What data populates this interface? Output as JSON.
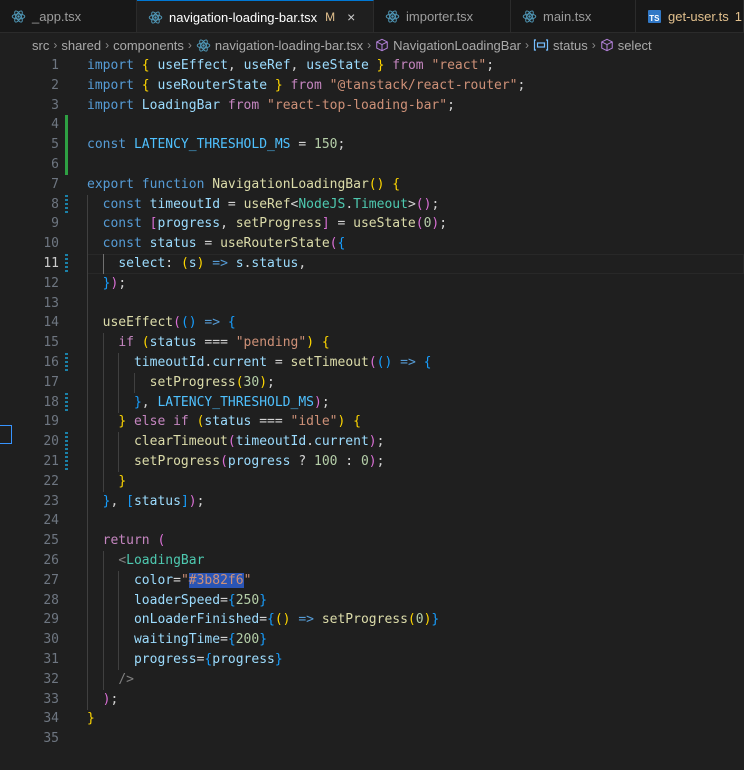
{
  "tabs": [
    {
      "label": "_app.tsx",
      "icon": "react-icon",
      "width": 137,
      "active": false
    },
    {
      "label": "navigation-loading-bar.tsx",
      "icon": "react-icon",
      "width": 237,
      "active": true,
      "modified": "M",
      "close": "×"
    },
    {
      "label": "importer.tsx",
      "icon": "react-icon",
      "width": 137,
      "active": false
    },
    {
      "label": "main.tsx",
      "icon": "react-icon",
      "width": 125,
      "active": false
    },
    {
      "label": "get-user.ts",
      "icon": "ts-icon",
      "width": 108,
      "active": false,
      "extra": "1"
    }
  ],
  "breadcrumb": {
    "parts": [
      "src",
      "shared",
      "components",
      "navigation-loading-bar.tsx",
      "NavigationLoadingBar",
      "status",
      "select"
    ]
  },
  "editor": {
    "current_line": 11,
    "lines": [
      {
        "n": "1",
        "t": [
          [
            "kw",
            "import"
          ],
          [
            "punc",
            " "
          ],
          [
            "b1",
            "{"
          ],
          [
            "punc",
            " "
          ],
          [
            "var",
            "useEffect"
          ],
          [
            "punc",
            ", "
          ],
          [
            "var",
            "useRef"
          ],
          [
            "punc",
            ", "
          ],
          [
            "var",
            "useState"
          ],
          [
            "punc",
            " "
          ],
          [
            "b1",
            "}"
          ],
          [
            "punc",
            " "
          ],
          [
            "ctl",
            "from"
          ],
          [
            "punc",
            " "
          ],
          [
            "str",
            "\"react\""
          ],
          [
            "punc",
            ";"
          ]
        ]
      },
      {
        "n": "2",
        "t": [
          [
            "kw",
            "import"
          ],
          [
            "punc",
            " "
          ],
          [
            "b1",
            "{"
          ],
          [
            "punc",
            " "
          ],
          [
            "var",
            "useRouterState"
          ],
          [
            "punc",
            " "
          ],
          [
            "b1",
            "}"
          ],
          [
            "punc",
            " "
          ],
          [
            "ctl",
            "from"
          ],
          [
            "punc",
            " "
          ],
          [
            "str",
            "\"@tanstack/react-router\""
          ],
          [
            "punc",
            ";"
          ]
        ]
      },
      {
        "n": "3",
        "t": [
          [
            "kw",
            "import"
          ],
          [
            "punc",
            " "
          ],
          [
            "var",
            "LoadingBar"
          ],
          [
            "punc",
            " "
          ],
          [
            "ctl",
            "from"
          ],
          [
            "punc",
            " "
          ],
          [
            "str",
            "\"react-top-loading-bar\""
          ],
          [
            "punc",
            ";"
          ]
        ]
      },
      {
        "n": "4",
        "t": [],
        "mark": "added"
      },
      {
        "n": "5",
        "t": [
          [
            "kw",
            "const"
          ],
          [
            "punc",
            " "
          ],
          [
            "cst",
            "LATENCY_THRESHOLD_MS"
          ],
          [
            "punc",
            " = "
          ],
          [
            "num",
            "150"
          ],
          [
            "punc",
            ";"
          ]
        ],
        "mark": "added"
      },
      {
        "n": "6",
        "t": [],
        "mark": "added"
      },
      {
        "n": "7",
        "t": [
          [
            "kw",
            "export"
          ],
          [
            "punc",
            " "
          ],
          [
            "kw",
            "function"
          ],
          [
            "punc",
            " "
          ],
          [
            "fn",
            "NavigationLoadingBar"
          ],
          [
            "b1",
            "()"
          ],
          [
            "punc",
            " "
          ],
          [
            "b1",
            "{"
          ]
        ]
      },
      {
        "n": "8",
        "t": [
          [
            "punc",
            "  "
          ],
          [
            "kw",
            "const"
          ],
          [
            "punc",
            " "
          ],
          [
            "var",
            "timeoutId"
          ],
          [
            "punc",
            " = "
          ],
          [
            "fn",
            "useRef"
          ],
          [
            "punc",
            "<"
          ],
          [
            "typ",
            "NodeJS"
          ],
          [
            "punc",
            "."
          ],
          [
            "typ",
            "Timeout"
          ],
          [
            "punc",
            ">"
          ],
          [
            "b2",
            "()"
          ],
          [
            "punc",
            ";"
          ]
        ],
        "mark": "modified"
      },
      {
        "n": "9",
        "t": [
          [
            "punc",
            "  "
          ],
          [
            "kw",
            "const"
          ],
          [
            "punc",
            " "
          ],
          [
            "b2",
            "["
          ],
          [
            "var",
            "progress"
          ],
          [
            "punc",
            ", "
          ],
          [
            "fn",
            "setProgress"
          ],
          [
            "b2",
            "]"
          ],
          [
            "punc",
            " = "
          ],
          [
            "fn",
            "useState"
          ],
          [
            "b2",
            "("
          ],
          [
            "num",
            "0"
          ],
          [
            "b2",
            ")"
          ],
          [
            "punc",
            ";"
          ]
        ]
      },
      {
        "n": "10",
        "t": [
          [
            "punc",
            "  "
          ],
          [
            "kw",
            "const"
          ],
          [
            "punc",
            " "
          ],
          [
            "var",
            "status"
          ],
          [
            "punc",
            " = "
          ],
          [
            "fn",
            "useRouterState"
          ],
          [
            "b2",
            "("
          ],
          [
            "b3",
            "{"
          ]
        ]
      },
      {
        "n": "11",
        "t": [
          [
            "punc",
            "    "
          ],
          [
            "var",
            "select"
          ],
          [
            "punc",
            ": "
          ],
          [
            "b1",
            "("
          ],
          [
            "var",
            "s"
          ],
          [
            "b1",
            ")"
          ],
          [
            "punc",
            " "
          ],
          [
            "kw",
            "=>"
          ],
          [
            "punc",
            " "
          ],
          [
            "var",
            "s"
          ],
          [
            "punc",
            "."
          ],
          [
            "var",
            "status"
          ],
          [
            "punc",
            ","
          ]
        ],
        "mark": "modified"
      },
      {
        "n": "12",
        "t": [
          [
            "punc",
            "  "
          ],
          [
            "b3",
            "}"
          ],
          [
            "b2",
            ")"
          ],
          [
            "punc",
            ";"
          ]
        ]
      },
      {
        "n": "13",
        "t": []
      },
      {
        "n": "14",
        "t": [
          [
            "punc",
            "  "
          ],
          [
            "fn",
            "useEffect"
          ],
          [
            "b2",
            "("
          ],
          [
            "b3",
            "()"
          ],
          [
            "punc",
            " "
          ],
          [
            "kw",
            "=>"
          ],
          [
            "punc",
            " "
          ],
          [
            "b3",
            "{"
          ]
        ]
      },
      {
        "n": "15",
        "t": [
          [
            "punc",
            "    "
          ],
          [
            "ctl",
            "if"
          ],
          [
            "punc",
            " "
          ],
          [
            "b1",
            "("
          ],
          [
            "var",
            "status"
          ],
          [
            "punc",
            " === "
          ],
          [
            "str",
            "\"pending\""
          ],
          [
            "b1",
            ")"
          ],
          [
            "punc",
            " "
          ],
          [
            "b1",
            "{"
          ]
        ]
      },
      {
        "n": "16",
        "t": [
          [
            "punc",
            "      "
          ],
          [
            "var",
            "timeoutId"
          ],
          [
            "punc",
            "."
          ],
          [
            "var",
            "current"
          ],
          [
            "punc",
            " = "
          ],
          [
            "fn",
            "setTimeout"
          ],
          [
            "b2",
            "("
          ],
          [
            "b3",
            "()"
          ],
          [
            "punc",
            " "
          ],
          [
            "kw",
            "=>"
          ],
          [
            "punc",
            " "
          ],
          [
            "b3",
            "{"
          ]
        ],
        "mark": "modified"
      },
      {
        "n": "17",
        "t": [
          [
            "punc",
            "        "
          ],
          [
            "fn",
            "setProgress"
          ],
          [
            "b1",
            "("
          ],
          [
            "num",
            "30"
          ],
          [
            "b1",
            ")"
          ],
          [
            "punc",
            ";"
          ]
        ]
      },
      {
        "n": "18",
        "t": [
          [
            "punc",
            "      "
          ],
          [
            "b3",
            "}"
          ],
          [
            "punc",
            ", "
          ],
          [
            "cst",
            "LATENCY_THRESHOLD_MS"
          ],
          [
            "b2",
            ")"
          ],
          [
            "punc",
            ";"
          ]
        ],
        "mark": "modified"
      },
      {
        "n": "19",
        "t": [
          [
            "punc",
            "    "
          ],
          [
            "b1",
            "}"
          ],
          [
            "punc",
            " "
          ],
          [
            "ctl",
            "else"
          ],
          [
            "punc",
            " "
          ],
          [
            "ctl",
            "if"
          ],
          [
            "punc",
            " "
          ],
          [
            "b1",
            "("
          ],
          [
            "var",
            "status"
          ],
          [
            "punc",
            " === "
          ],
          [
            "str",
            "\"idle\""
          ],
          [
            "b1",
            ")"
          ],
          [
            "punc",
            " "
          ],
          [
            "b1",
            "{"
          ]
        ]
      },
      {
        "n": "20",
        "t": [
          [
            "punc",
            "      "
          ],
          [
            "fn",
            "clearTimeout"
          ],
          [
            "b2",
            "("
          ],
          [
            "var",
            "timeoutId"
          ],
          [
            "punc",
            "."
          ],
          [
            "var",
            "current"
          ],
          [
            "b2",
            ")"
          ],
          [
            "punc",
            ";"
          ]
        ],
        "mark": "modified"
      },
      {
        "n": "21",
        "t": [
          [
            "punc",
            "      "
          ],
          [
            "fn",
            "setProgress"
          ],
          [
            "b2",
            "("
          ],
          [
            "var",
            "progress"
          ],
          [
            "punc",
            " ? "
          ],
          [
            "num",
            "100"
          ],
          [
            "punc",
            " : "
          ],
          [
            "num",
            "0"
          ],
          [
            "b2",
            ")"
          ],
          [
            "punc",
            ";"
          ]
        ],
        "mark": "modified"
      },
      {
        "n": "22",
        "t": [
          [
            "punc",
            "    "
          ],
          [
            "b1",
            "}"
          ]
        ]
      },
      {
        "n": "23",
        "t": [
          [
            "punc",
            "  "
          ],
          [
            "b3",
            "}"
          ],
          [
            "punc",
            ", "
          ],
          [
            "b3",
            "["
          ],
          [
            "var",
            "status"
          ],
          [
            "b3",
            "]"
          ],
          [
            "b2",
            ")"
          ],
          [
            "punc",
            ";"
          ]
        ]
      },
      {
        "n": "24",
        "t": []
      },
      {
        "n": "25",
        "t": [
          [
            "punc",
            "  "
          ],
          [
            "ctl",
            "return"
          ],
          [
            "punc",
            " "
          ],
          [
            "b2",
            "("
          ]
        ]
      },
      {
        "n": "26",
        "t": [
          [
            "punc",
            "    "
          ],
          [
            "tagpunc",
            "<"
          ],
          [
            "tag",
            "LoadingBar"
          ]
        ]
      },
      {
        "n": "27",
        "t": [
          [
            "punc",
            "      "
          ],
          [
            "attr",
            "color"
          ],
          [
            "punc",
            "="
          ],
          [
            "str",
            "\""
          ],
          [
            "selhl",
            "#3b82f6"
          ],
          [
            "str",
            "\""
          ]
        ]
      },
      {
        "n": "28",
        "t": [
          [
            "punc",
            "      "
          ],
          [
            "attr",
            "loaderSpeed"
          ],
          [
            "punc",
            "="
          ],
          [
            "b3",
            "{"
          ],
          [
            "num",
            "250"
          ],
          [
            "b3",
            "}"
          ]
        ]
      },
      {
        "n": "29",
        "t": [
          [
            "punc",
            "      "
          ],
          [
            "attr",
            "onLoaderFinished"
          ],
          [
            "punc",
            "="
          ],
          [
            "b3",
            "{"
          ],
          [
            "b1",
            "()"
          ],
          [
            "punc",
            " "
          ],
          [
            "kw",
            "=>"
          ],
          [
            "punc",
            " "
          ],
          [
            "fn",
            "setProgress"
          ],
          [
            "b1",
            "("
          ],
          [
            "num",
            "0"
          ],
          [
            "b1",
            ")"
          ],
          [
            "b3",
            "}"
          ]
        ]
      },
      {
        "n": "30",
        "t": [
          [
            "punc",
            "      "
          ],
          [
            "attr",
            "waitingTime"
          ],
          [
            "punc",
            "="
          ],
          [
            "b3",
            "{"
          ],
          [
            "num",
            "200"
          ],
          [
            "b3",
            "}"
          ]
        ]
      },
      {
        "n": "31",
        "t": [
          [
            "punc",
            "      "
          ],
          [
            "attr",
            "progress"
          ],
          [
            "punc",
            "="
          ],
          [
            "b3",
            "{"
          ],
          [
            "var",
            "progress"
          ],
          [
            "b3",
            "}"
          ]
        ]
      },
      {
        "n": "32",
        "t": [
          [
            "punc",
            "    "
          ],
          [
            "tagpunc",
            "/>"
          ]
        ]
      },
      {
        "n": "33",
        "t": [
          [
            "punc",
            "  "
          ],
          [
            "b2",
            ")"
          ],
          [
            "punc",
            ";"
          ]
        ]
      },
      {
        "n": "34",
        "t": [
          [
            "b1",
            "}"
          ]
        ]
      },
      {
        "n": "35",
        "t": []
      }
    ]
  },
  "colors": {
    "accent": "#0078d4",
    "added": "#2ea043",
    "modified": "#1b81a8",
    "ts_badge": "#3178c6",
    "react": "#519aba"
  }
}
